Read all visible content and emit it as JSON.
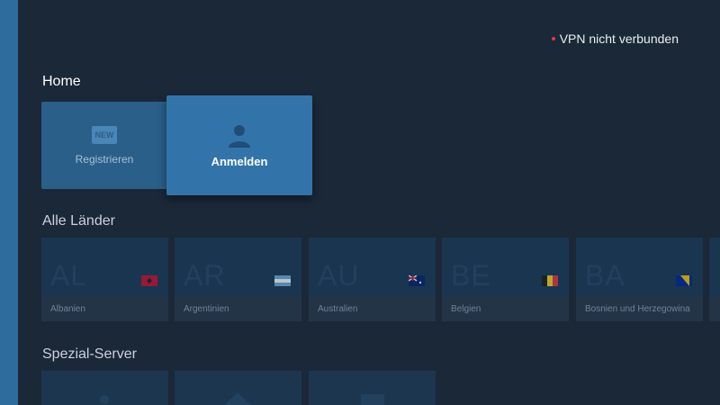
{
  "status": {
    "text": "VPN nicht verbunden",
    "dot_color": "#e0394a"
  },
  "home": {
    "title": "Home",
    "register": {
      "label": "Registrieren",
      "badge": "NEW"
    },
    "login": {
      "label": "Anmelden",
      "icon": "person-icon"
    }
  },
  "countries": {
    "title": "Alle Länder",
    "items": [
      {
        "code": "AL",
        "name": "Albanien"
      },
      {
        "code": "AR",
        "name": "Argentinien"
      },
      {
        "code": "AU",
        "name": "Australien"
      },
      {
        "code": "BE",
        "name": "Belgien"
      },
      {
        "code": "BA",
        "name": "Bosnien und Herzegowina"
      }
    ]
  },
  "special": {
    "title": "Spezial-Server"
  }
}
